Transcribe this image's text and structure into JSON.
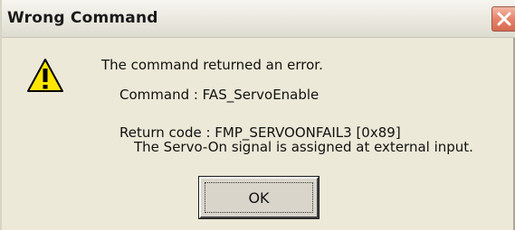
{
  "window": {
    "title": "Wrong Command",
    "close_icon": "close-icon"
  },
  "dialog": {
    "icon": "warning-icon",
    "message": "The command returned an error.",
    "command_line": "Command : FAS_ServoEnable",
    "return_code_line": "Return code : FMP_SERVOONFAIL3 [0x89]",
    "description_line": "The Servo-On signal is assigned at external input."
  },
  "buttons": {
    "ok_label": "OK"
  },
  "colors": {
    "dialog_bg": "#ece9d8",
    "close_button": "#e5846b",
    "warning_yellow": "#ffe600"
  }
}
